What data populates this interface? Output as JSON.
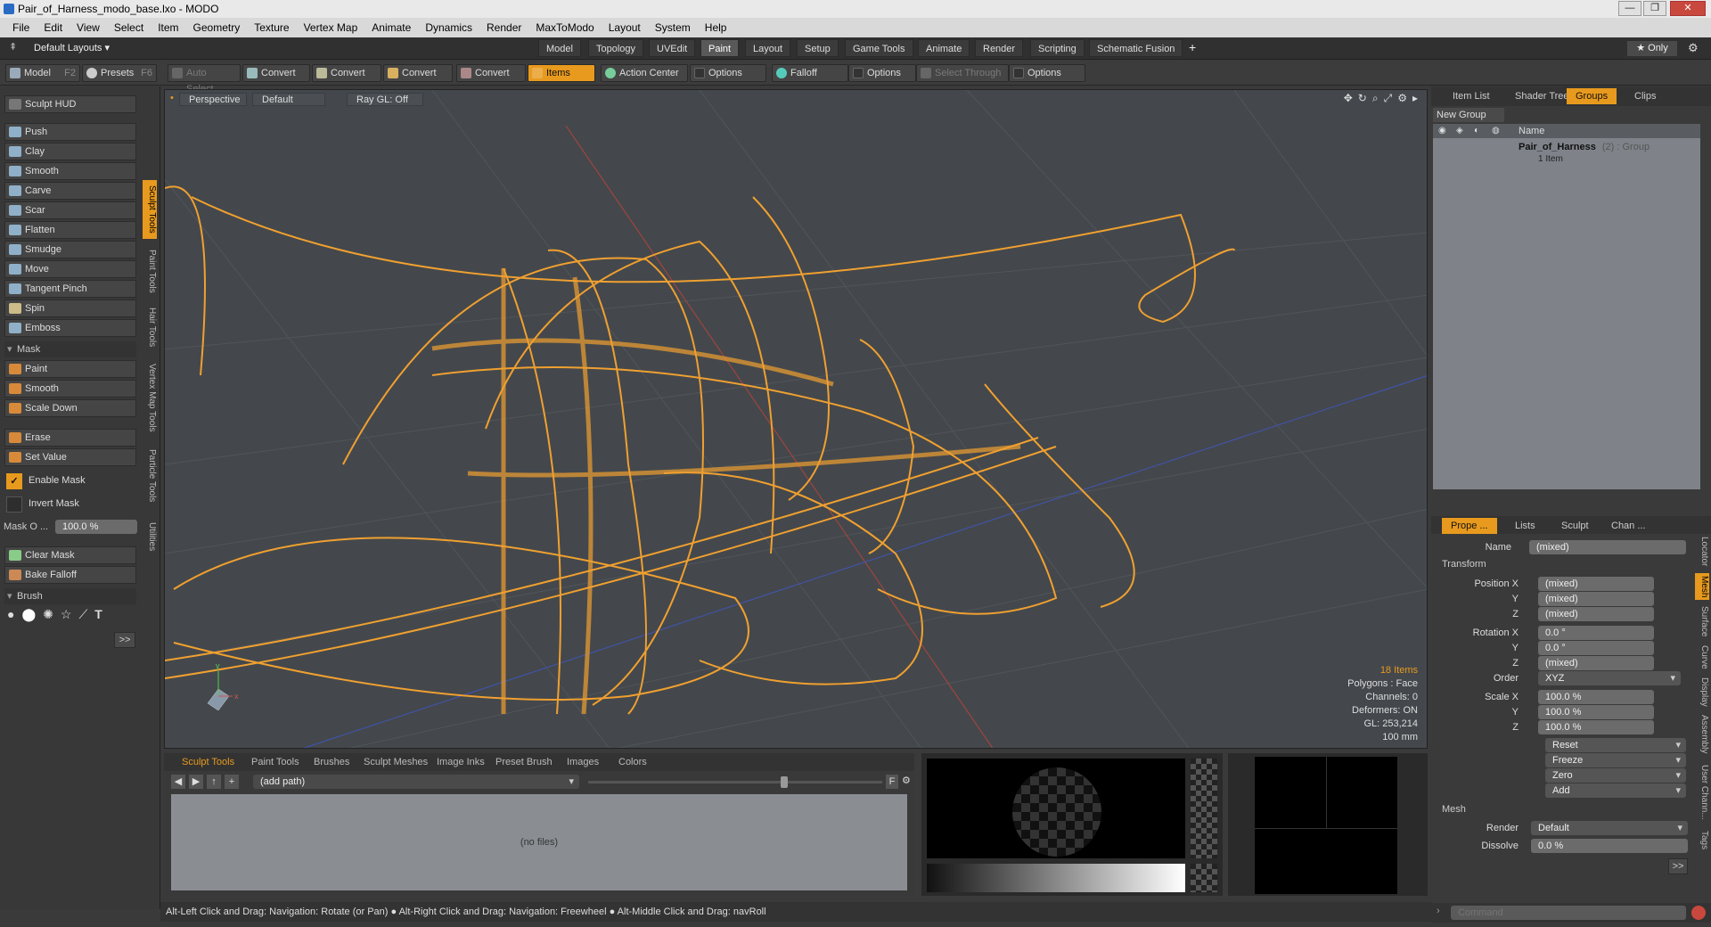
{
  "window": {
    "title": "Pair_of_Harness_modo_base.lxo - MODO",
    "min": "—",
    "max": "❐",
    "close": "✕"
  },
  "menu": [
    "File",
    "Edit",
    "View",
    "Select",
    "Item",
    "Geometry",
    "Texture",
    "Vertex Map",
    "Animate",
    "Dynamics",
    "Render",
    "MaxToModo",
    "Layout",
    "System",
    "Help"
  ],
  "layoutbar": {
    "layout_name": "Default Layouts ▾",
    "tabs": [
      "Model",
      "Topology",
      "UVEdit",
      "Paint",
      "Layout",
      "Setup",
      "Game Tools",
      "Animate",
      "Render",
      "Scripting",
      "Schematic Fusion"
    ],
    "active_tab": "Paint",
    "add": "+",
    "only_label": "★ Only",
    "gear": "⚙"
  },
  "toolbar": {
    "model": "Model",
    "model_key": "F2",
    "presets": "Presets",
    "presets_key": "F6",
    "auto_select": "Auto Select",
    "convert1": "Convert",
    "convert2": "Convert",
    "convert3": "Convert",
    "convert4": "Convert",
    "items": "Items",
    "action_center": "Action Center",
    "options1": "Options",
    "falloff": "Falloff",
    "options2": "Options",
    "select_through": "Select Through",
    "options3": "Options"
  },
  "sculpt": {
    "hud": "Sculpt HUD",
    "tools": [
      "Push",
      "Clay",
      "Smooth",
      "Carve",
      "Scar",
      "Flatten",
      "Smudge",
      "Move",
      "Tangent Pinch",
      "Spin",
      "Emboss"
    ],
    "mask_header": "Mask",
    "mask_tools": [
      "Paint",
      "Smooth",
      "Scale Down"
    ],
    "erase": "Erase",
    "set_value": "Set Value",
    "enable_mask": "Enable Mask",
    "invert_mask": "Invert Mask",
    "mask_opacity_label": "Mask O ...",
    "mask_opacity_value": "100.0 %",
    "clear_mask": "Clear Mask",
    "bake_falloff": "Bake Falloff",
    "brush_header": "Brush",
    "more": ">>"
  },
  "vertical_tabs": [
    "Sculpt Tools",
    "Paint Tools",
    "Hair Tools",
    "Vertex Map Tools",
    "Particle Tools",
    "Utilities"
  ],
  "viewport": {
    "view": "Perspective",
    "shading": "Default",
    "raygl": "Ray GL: Off",
    "stats": {
      "items": "18 Items",
      "polygons": "Polygons : Face",
      "channels": "Channels: 0",
      "deformers": "Deformers: ON",
      "gl": "GL: 253,214",
      "scale": "100 mm"
    },
    "colors": {
      "wire": "#f0a030",
      "bg": "#44484c"
    }
  },
  "right": {
    "tabs": [
      "Item List",
      "Shader Tree",
      "Groups",
      "Clips"
    ],
    "active_tab": "Groups",
    "new_group": "New Group",
    "col_name": "Name",
    "group_name": "Pair_of_Harness",
    "group_meta": "(2) : Group",
    "group_sub": "1 Item",
    "prop_tabs": [
      "Prope ...",
      "Lists",
      "Sculpt",
      "Chan ..."
    ],
    "side_tabs": [
      "Locator",
      "Mesh",
      "Surface",
      "Curve",
      "Display",
      "Assembly",
      "User Chann...",
      "Tags"
    ],
    "name_label": "Name",
    "name_value": "(mixed)",
    "transform_header": "Transform",
    "position_label": "Position X",
    "y": "Y",
    "z": "Z",
    "position": [
      "(mixed)",
      "(mixed)",
      "(mixed)"
    ],
    "rotation_label": "Rotation X",
    "rotation": [
      "0.0 °",
      "0.0 °",
      "(mixed)"
    ],
    "order_label": "Order",
    "order_value": "XYZ",
    "scale_label": "Scale X",
    "scale": [
      "100.0 %",
      "100.0 %",
      "100.0 %"
    ],
    "actions": [
      "Reset",
      "Freeze",
      "Zero",
      "Add"
    ],
    "mesh_header": "Mesh",
    "render_label": "Render",
    "render_value": "Default",
    "dissolve_label": "Dissolve",
    "dissolve_value": "0.0 %",
    "more": ">>",
    "command_placeholder": "Command"
  },
  "bottom": {
    "tabs": [
      "Sculpt Tools",
      "Paint Tools",
      "Brushes",
      "Sculpt Meshes",
      "Image Inks",
      "Preset Brush",
      "Images",
      "Colors"
    ],
    "active_tab": "Sculpt Tools",
    "path": "(add path)",
    "no_files": "(no files)",
    "f_btn": "F"
  },
  "status": "Alt-Left Click and Drag: Navigation: Rotate (or Pan) ● Alt-Right Click and Drag: Navigation: Freewheel ● Alt-Middle Click and Drag: navRoll"
}
